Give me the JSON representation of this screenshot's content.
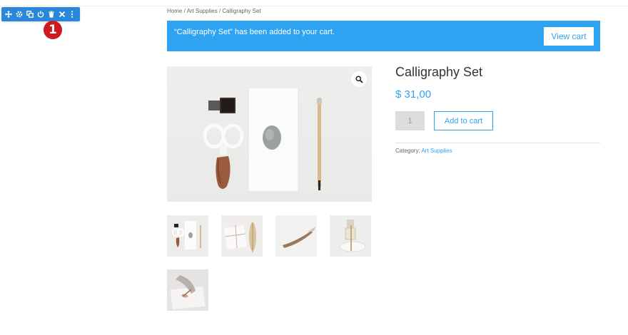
{
  "toolbar": {
    "icons": [
      "move-icon",
      "settings-icon",
      "duplicate-icon",
      "power-icon",
      "trash-icon",
      "close-icon",
      "more-icon"
    ],
    "color": "#2b87da"
  },
  "step_badge": "1",
  "breadcrumb": {
    "home": "Home",
    "sep1": " / ",
    "category": "Art Supplies",
    "sep2": " / ",
    "current": "Calligraphy Set"
  },
  "notice": {
    "message": "“Calligraphy Set” has been added to your cart.",
    "button_label": "View cart",
    "color": "#2ea3f2"
  },
  "product": {
    "title": "Calligraphy Set",
    "price": "$ 31,00",
    "quantity": "1",
    "add_to_cart_label": "Add to cart",
    "category_label": "Category:",
    "category_link": "Art Supplies",
    "accent": "#2ea3f2"
  },
  "gallery": {
    "thumbnail_count": 5
  }
}
